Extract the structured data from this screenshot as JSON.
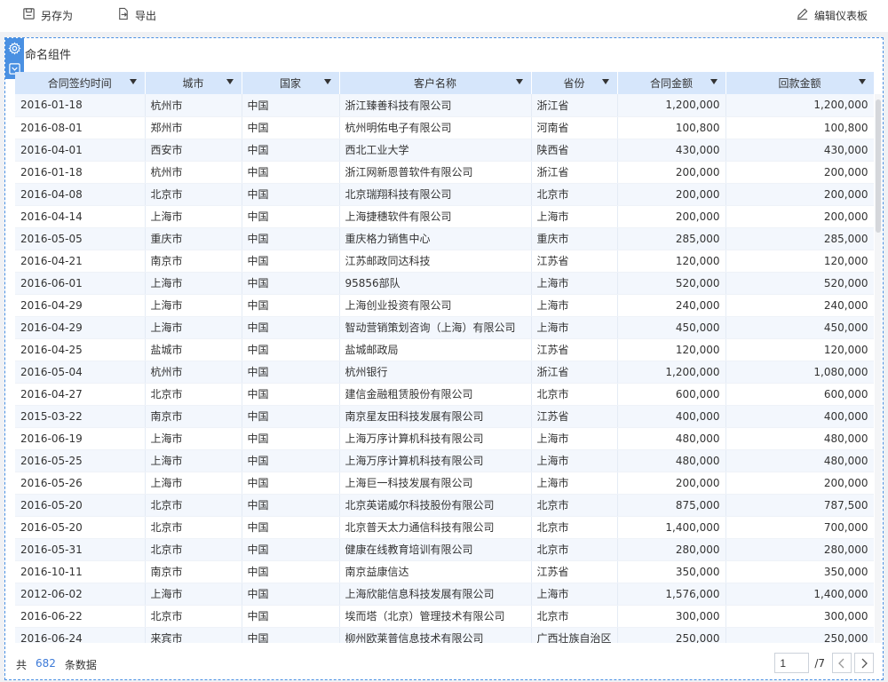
{
  "toolbar": {
    "save_as": {
      "label": "另存为",
      "icon": "save-icon"
    },
    "export": {
      "label": "导出",
      "icon": "export-icon"
    },
    "edit_dashboard": {
      "label": "编辑仪表板",
      "icon": "edit-icon"
    }
  },
  "component": {
    "title": "命名组件",
    "icons": [
      "gear-icon",
      "collapse-icon"
    ]
  },
  "table": {
    "columns": [
      {
        "label": "合同签约时间",
        "sortable": true
      },
      {
        "label": "城市",
        "sortable": true
      },
      {
        "label": "国家",
        "sortable": true
      },
      {
        "label": "客户名称",
        "sortable": true
      },
      {
        "label": "省份",
        "sortable": true
      },
      {
        "label": "合同金额",
        "sortable": true
      },
      {
        "label": "回款金额",
        "sortable": true
      }
    ],
    "rows": [
      [
        "2016-01-18",
        "杭州市",
        "中国",
        "浙江臻善科技有限公司",
        "浙江省",
        "1,200,000",
        "1,200,000"
      ],
      [
        "2016-08-01",
        "郑州市",
        "中国",
        "杭州明佑电子有限公司",
        "河南省",
        "100,800",
        "100,800"
      ],
      [
        "2016-04-01",
        "西安市",
        "中国",
        "西北工业大学",
        "陕西省",
        "430,000",
        "430,000"
      ],
      [
        "2016-01-18",
        "杭州市",
        "中国",
        "浙江网新恩普软件有限公司",
        "浙江省",
        "200,000",
        "200,000"
      ],
      [
        "2016-04-08",
        "北京市",
        "中国",
        "北京瑞翔科技有限公司",
        "北京市",
        "200,000",
        "200,000"
      ],
      [
        "2016-04-14",
        "上海市",
        "中国",
        "上海捷穗软件有限公司",
        "上海市",
        "200,000",
        "200,000"
      ],
      [
        "2016-05-05",
        "重庆市",
        "中国",
        "重庆格力销售中心",
        "重庆市",
        "285,000",
        "285,000"
      ],
      [
        "2016-04-21",
        "南京市",
        "中国",
        "江苏邮政同达科技",
        "江苏省",
        "120,000",
        "120,000"
      ],
      [
        "2016-06-01",
        "上海市",
        "中国",
        "95856部队",
        "上海市",
        "520,000",
        "520,000"
      ],
      [
        "2016-04-29",
        "上海市",
        "中国",
        "上海创业投资有限公司",
        "上海市",
        "240,000",
        "240,000"
      ],
      [
        "2016-04-29",
        "上海市",
        "中国",
        "智动营销策划咨询（上海）有限公司",
        "上海市",
        "450,000",
        "450,000"
      ],
      [
        "2016-04-25",
        "盐城市",
        "中国",
        "盐城邮政局",
        "江苏省",
        "120,000",
        "120,000"
      ],
      [
        "2016-05-04",
        "杭州市",
        "中国",
        "杭州银行",
        "浙江省",
        "1,200,000",
        "1,080,000"
      ],
      [
        "2016-04-27",
        "北京市",
        "中国",
        "建信金融租赁股份有限公司",
        "北京市",
        "600,000",
        "600,000"
      ],
      [
        "2015-03-22",
        "南京市",
        "中国",
        "南京星友田科技发展有限公司",
        "江苏省",
        "400,000",
        "400,000"
      ],
      [
        "2016-06-19",
        "上海市",
        "中国",
        "上海万序计算机科技有限公司",
        "上海市",
        "480,000",
        "480,000"
      ],
      [
        "2016-05-25",
        "上海市",
        "中国",
        "上海万序计算机科技有限公司",
        "上海市",
        "480,000",
        "480,000"
      ],
      [
        "2016-05-26",
        "上海市",
        "中国",
        "上海巨一科技发展有限公司",
        "上海市",
        "200,000",
        "200,000"
      ],
      [
        "2016-05-20",
        "北京市",
        "中国",
        "北京英诺威尔科技股份有限公司",
        "北京市",
        "875,000",
        "787,500"
      ],
      [
        "2016-05-20",
        "北京市",
        "中国",
        "北京普天太力通信科技有限公司",
        "北京市",
        "1,400,000",
        "700,000"
      ],
      [
        "2016-05-31",
        "北京市",
        "中国",
        "健康在线教育培训有限公司",
        "北京市",
        "280,000",
        "280,000"
      ],
      [
        "2016-10-11",
        "南京市",
        "中国",
        "南京益康信达",
        "江苏省",
        "350,000",
        "350,000"
      ],
      [
        "2012-06-02",
        "上海市",
        "中国",
        "上海欣能信息科技发展有限公司",
        "上海市",
        "1,576,000",
        "1,400,000"
      ],
      [
        "2016-06-22",
        "北京市",
        "中国",
        "埃而塔（北京）管理技术有限公司",
        "北京市",
        "300,000",
        "300,000"
      ],
      [
        "2016-06-24",
        "来宾市",
        "中国",
        "柳州欧莱普信息技术有限公司",
        "广西壮族自治区",
        "250,000",
        "250,000"
      ]
    ]
  },
  "footer": {
    "total_prefix": "共",
    "total_count": "682",
    "total_suffix": "条数据",
    "page_value": "1",
    "page_total": "/7"
  },
  "colors": {
    "accent": "#4a90e2",
    "header_bg": "#d6e6fb",
    "row_alt": "#f3f7fd",
    "count_link": "#3d7ad8"
  }
}
